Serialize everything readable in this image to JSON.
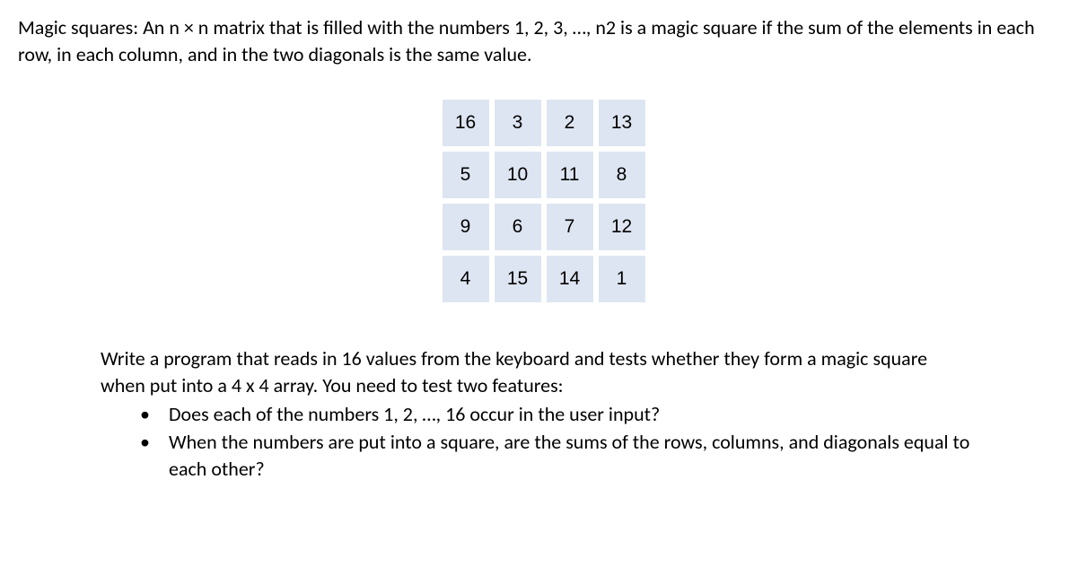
{
  "intro": "Magic squares:  An n × n matrix that is filled with the numbers 1, 2, 3, …, n2 is a magic square if the sum of the elements in each row, in each column, and in the two diagonals is the same value.",
  "chart_data": {
    "type": "table",
    "rows": [
      [
        16,
        3,
        2,
        13
      ],
      [
        5,
        10,
        11,
        8
      ],
      [
        9,
        6,
        7,
        12
      ],
      [
        4,
        15,
        14,
        1
      ]
    ]
  },
  "task": {
    "intro": "Write a program that reads in 16 values from the keyboard and tests whether they form a magic square when put into a 4 x 4 array. You need to test two features:",
    "bullets": [
      "Does each of the numbers 1, 2, …, 16 occur in the user input?",
      "When the numbers are put into a square, are the sums of the rows, columns, and diagonals equal to each other?"
    ]
  }
}
